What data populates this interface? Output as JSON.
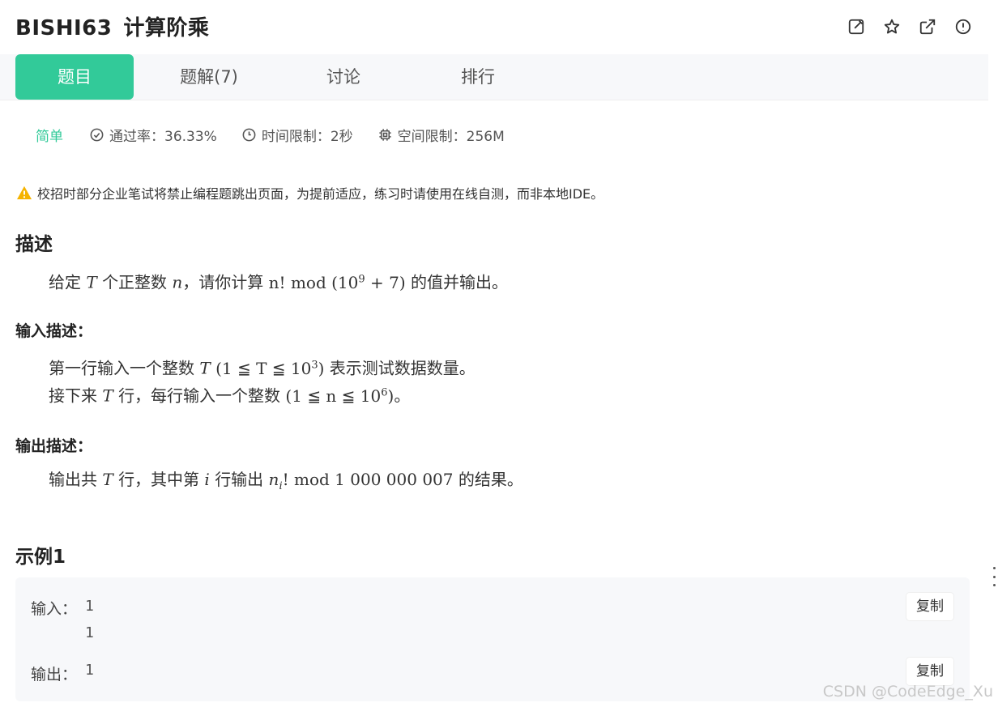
{
  "header": {
    "code": "BISHI63",
    "name": "计算阶乘",
    "icons": [
      "edit-icon",
      "star-icon",
      "external-link-icon",
      "info-icon"
    ]
  },
  "tabs": [
    {
      "label": "题目",
      "active": true
    },
    {
      "label": "题解(7)",
      "active": false
    },
    {
      "label": "讨论",
      "active": false
    },
    {
      "label": "排行",
      "active": false
    }
  ],
  "meta": {
    "difficulty": "简单",
    "pass_rate": "通过率：36.33%",
    "time_limit": "时间限制：2秒",
    "space_limit": "空间限制：256M"
  },
  "warning": "校招时部分企业笔试将禁止编程题跳出页面，为提前适应，练习时请使用在线自测，而非本地IDE。",
  "description": {
    "heading": "描述",
    "p1": "给定",
    "p2": "个正整数",
    "p3": "，请你计算",
    "p4": "的值并输出。"
  },
  "input": {
    "heading": "输入描述：",
    "l1a": "第一行输入一个整数",
    "l1b": "表示测试数据数量。",
    "l2a": "接下来",
    "l2b": "行，每行输入一个整数",
    "l2c": "。"
  },
  "output": {
    "heading": "输出描述：",
    "a": "输出共",
    "b": "行，其中第",
    "c": "行输出",
    "d": "的结果。"
  },
  "math": {
    "T": "T",
    "n": "n",
    "i": "i",
    "fact": "n! mod (10",
    "exp9": "9",
    "plus7": " + 7)",
    "t_range_a": "1 ≦ T ≦ 10",
    "exp3": "3",
    "n_range_a": "1 ≦ n ≦ 10",
    "exp6": "6",
    "out_mod": "! mod 1 000 000 007"
  },
  "example": {
    "heading": "示例1",
    "input_label": "输入：",
    "input_lines": [
      "1",
      "1"
    ],
    "output_label": "输出：",
    "output_value": "1",
    "copy_label": "复制"
  },
  "watermark": "CSDN @CodeEdge_Xu"
}
